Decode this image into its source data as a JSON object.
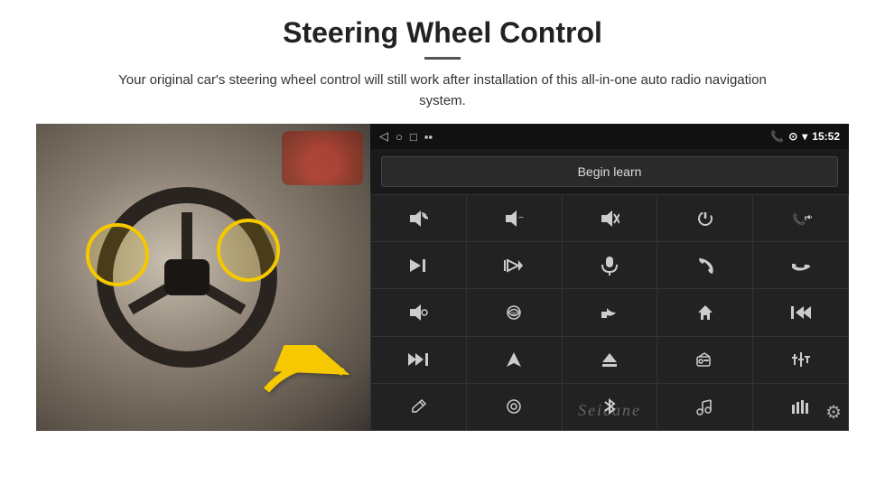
{
  "header": {
    "title": "Steering Wheel Control",
    "subtitle": "Your original car's steering wheel control will still work after installation of this all-in-one auto radio navigation system."
  },
  "statusBar": {
    "back": "◁",
    "circle": "○",
    "square": "□",
    "sim": "▪▪",
    "phone": "📞",
    "location": "◈",
    "wifi": "▾",
    "time": "15:52"
  },
  "beginLearnBtn": "Begin learn",
  "grid": {
    "rows": [
      [
        "🔊+",
        "🔊−",
        "🔇",
        "⏻",
        "📞⏮"
      ],
      [
        "⏭",
        "⏸⏭",
        "🎤",
        "📞",
        "📞↩"
      ],
      [
        "📢",
        "360°",
        "↩",
        "🏠",
        "⏮⏮"
      ],
      [
        "⏭⏭",
        "▶",
        "⏏",
        "📻",
        "🎛"
      ],
      [
        "🎙",
        "⚙",
        "🎵*",
        "🎵*",
        "📊"
      ]
    ],
    "icons": [
      [
        "vol_up",
        "vol_down",
        "mute",
        "power",
        "phone_prev"
      ],
      [
        "next",
        "pause_next",
        "mic",
        "phone",
        "hang_up"
      ],
      [
        "speaker",
        "cam_360",
        "back",
        "home",
        "prev_prev"
      ],
      [
        "next_next",
        "navigate",
        "eject",
        "radio",
        "equalizer"
      ],
      [
        "pen",
        "circle_btn",
        "bluetooth",
        "music_eq",
        "bars"
      ]
    ]
  },
  "watermark": "Seicane",
  "gear": "⚙"
}
